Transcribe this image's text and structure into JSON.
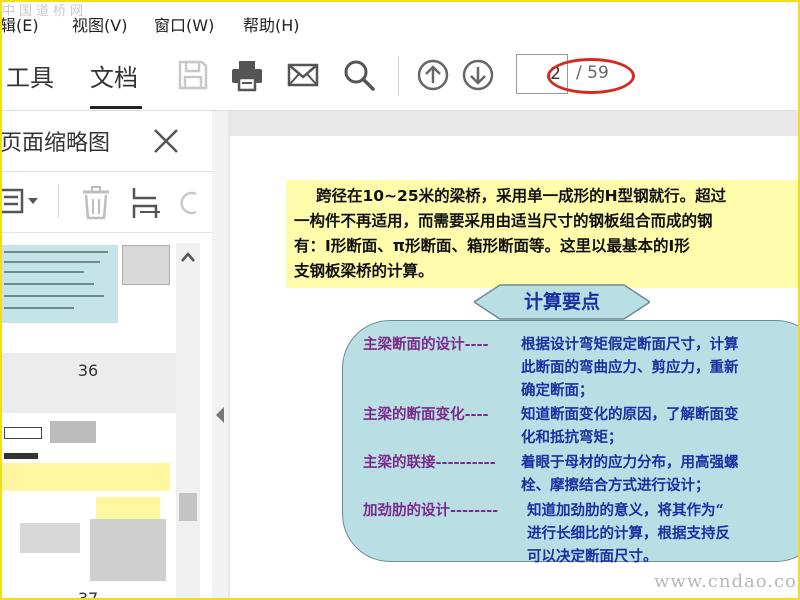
{
  "watermark": {
    "top": "中国道桥网",
    "bottom": "www.cndao.com"
  },
  "menu": {
    "items": [
      "辑(E)",
      "视图(V)",
      "窗口(W)",
      "帮助(H)"
    ]
  },
  "toolbar": {
    "tabs": [
      "工具",
      "文档"
    ],
    "active_tab": "文档",
    "icons": [
      "save-icon",
      "print-icon",
      "mail-icon",
      "search-icon",
      "page-up-icon",
      "page-down-icon"
    ],
    "page_current": "2",
    "page_total": "/ 59"
  },
  "sidebar": {
    "title": "页面缩略图",
    "tool_icons": [
      "thumbnail-options-icon",
      "delete-icon",
      "extract-icon",
      "rotate-icon"
    ],
    "thumb_labels": [
      "36",
      "37"
    ]
  },
  "document": {
    "highlight_lines": [
      "跨径在10~25米的梁桥，采用单一成形的H型钢就行。超过",
      "一构件不再适用，而需要采用由适当尺寸的钢板组合而成的钢",
      "有：Ⅰ形断面、π形断面、箱形断面等。这里以最基本的Ⅰ形",
      "支钢板梁桥的计算。"
    ],
    "section_title": "计算要点",
    "rows": [
      {
        "label": "主梁断面的设计----",
        "lines": [
          "根据设计弯矩假定断面尺寸，计算",
          "此断面的弯曲应力、剪应力，重新",
          "确定断面；"
        ]
      },
      {
        "label": "主梁的断面变化----",
        "lines": [
          "知道断面变化的原因，了解断面变",
          "化和抵抗弯矩；"
        ]
      },
      {
        "label": "主梁的联接----------",
        "lines": [
          "着眼于母材的应力分布，用高强螺",
          "栓、摩擦结合方式进行设计；"
        ]
      },
      {
        "label": "加劲肋的设计--------",
        "lines": [
          "知道加劲肋的意义，将其作为“",
          "进行长细比的计算，根据支持反",
          "可以决定断面尺寸。"
        ]
      }
    ]
  },
  "colors": {
    "frame": "#f3dc1a",
    "highlight": "#fffcab",
    "box": "#b9dfe4",
    "label": "#7a2a87",
    "text": "#1a2fa0",
    "ellipse": "#d62a20"
  }
}
